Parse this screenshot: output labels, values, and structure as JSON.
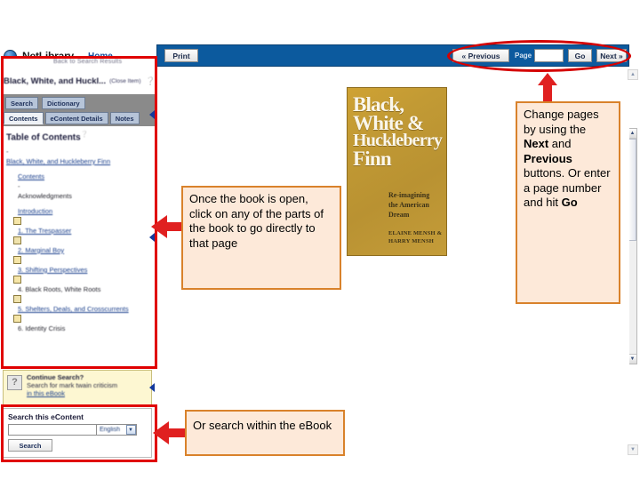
{
  "app": {
    "brand": "NetLibrary",
    "home_link": "Home",
    "back_link": "Back to Search Results",
    "globe_icon": "globe-icon"
  },
  "item": {
    "title": "Black, White, and Huckl...",
    "close_label": "(Close Item)",
    "help_icon": "help-question-icon"
  },
  "tabs": {
    "row1": [
      {
        "label": "Search",
        "selected": false
      },
      {
        "label": "Dictionary",
        "selected": false
      }
    ],
    "row2": [
      {
        "label": "Contents",
        "selected": true
      },
      {
        "label": "eContent Details",
        "selected": false
      },
      {
        "label": "Notes",
        "selected": false
      }
    ]
  },
  "toc": {
    "heading": "Table of Contents",
    "heading_help": "help-icon",
    "root_toggle": "-",
    "root": "Black, White, and Huckleberry Finn",
    "entries": [
      {
        "label": "Contents",
        "link": true,
        "box": false
      },
      {
        "label": "-",
        "link": false,
        "box": false,
        "dash": true
      },
      {
        "label": "Acknowledgments",
        "link": false,
        "box": false
      },
      {
        "label": "Introduction",
        "link": true,
        "box": false
      },
      {
        "label": "1.  The Trespasser",
        "link": true,
        "box": true
      },
      {
        "label": "2.  Marginal Boy",
        "link": true,
        "box": true
      },
      {
        "label": "3.  Shifting Perspectives",
        "link": true,
        "box": true
      },
      {
        "label": "4.  Black Roots, White Roots",
        "link": false,
        "box": true
      },
      {
        "label": "5.  Shelters, Deals, and Crosscurrents",
        "link": true,
        "box": true
      },
      {
        "label": "6.  Identity Crisis",
        "link": false,
        "box": true
      }
    ]
  },
  "continue_search": {
    "icon": "question-mark-icon",
    "title": "Continue Search?",
    "text": "Search for mark twain criticism",
    "link": "in this eBook"
  },
  "search_panel": {
    "label": "Search this eContent",
    "input_value": "",
    "input_placeholder": "",
    "language": "English",
    "dropdown_icon": "chevron-down-icon",
    "button": "Search"
  },
  "toolbar": {
    "print": "Print",
    "previous": "« Previous",
    "page_label": "Page",
    "page_value": "",
    "go": "Go",
    "next": "Next »"
  },
  "book_cover": {
    "title_line1": "Black,",
    "title_line2": "White &",
    "title_line3": "Huckleberry",
    "title_line4": "Finn",
    "subtitle_line1": "Re-imagining",
    "subtitle_line2": "the American",
    "subtitle_line3": "Dream",
    "author_line1": "ELAINE MENSH &",
    "author_line2": "HARRY MENSH",
    "bg_color": "#c29a34"
  },
  "annotations": {
    "callout_toc": {
      "text": "Once the book is open, click on any of the parts of the book to go directly to that page"
    },
    "callout_page": {
      "part1": "Change pages by using the ",
      "bold1": "Next",
      "part2": " and ",
      "bold2": "Previous",
      "part3": " buttons. Or enter a page number and hit ",
      "bold3": "Go"
    },
    "callout_search": {
      "text": "Or search within the eBook"
    },
    "highlight_color": "#e00000",
    "callout_border_color": "#d9822b",
    "callout_fill_color": "#fde9d9"
  },
  "scrollbars": {
    "up_arrow": "scroll-up-arrow",
    "down_arrow": "scroll-down-arrow"
  }
}
